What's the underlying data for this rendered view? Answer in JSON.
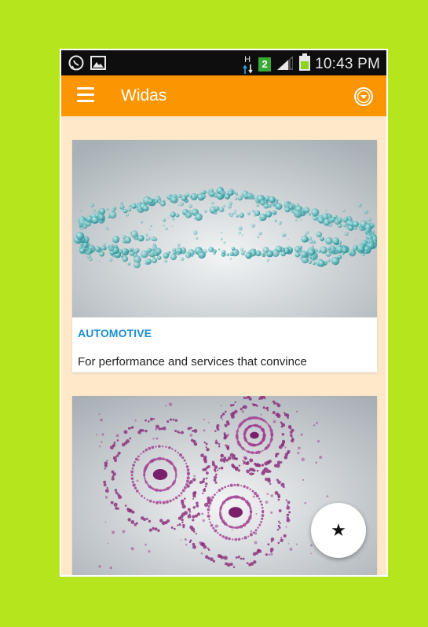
{
  "status_bar": {
    "time": "10:43 PM",
    "network_letter": "H",
    "sim_number": "2",
    "icons": [
      "whatsapp-icon",
      "image-icon",
      "data-arrows-icon",
      "sim2-icon",
      "signal-icon",
      "battery-icon"
    ]
  },
  "app_bar": {
    "title": "Widas",
    "menu_icon": "hamburger-menu-icon",
    "action_icon": "chevron-down-circle-icon",
    "background": "#fb9502"
  },
  "cards": [
    {
      "image": "car-particles-illustration",
      "category": "AUTOMOTIVE",
      "description": "For performance and services that convince"
    },
    {
      "image": "gears-particles-illustration"
    }
  ],
  "fab": {
    "icon": "star-icon",
    "glyph": "★"
  },
  "colors": {
    "page_background": "#b5e51d",
    "accent_orange": "#fb9502",
    "category_blue": "#1a8fcf",
    "content_background": "#fde8c9"
  }
}
